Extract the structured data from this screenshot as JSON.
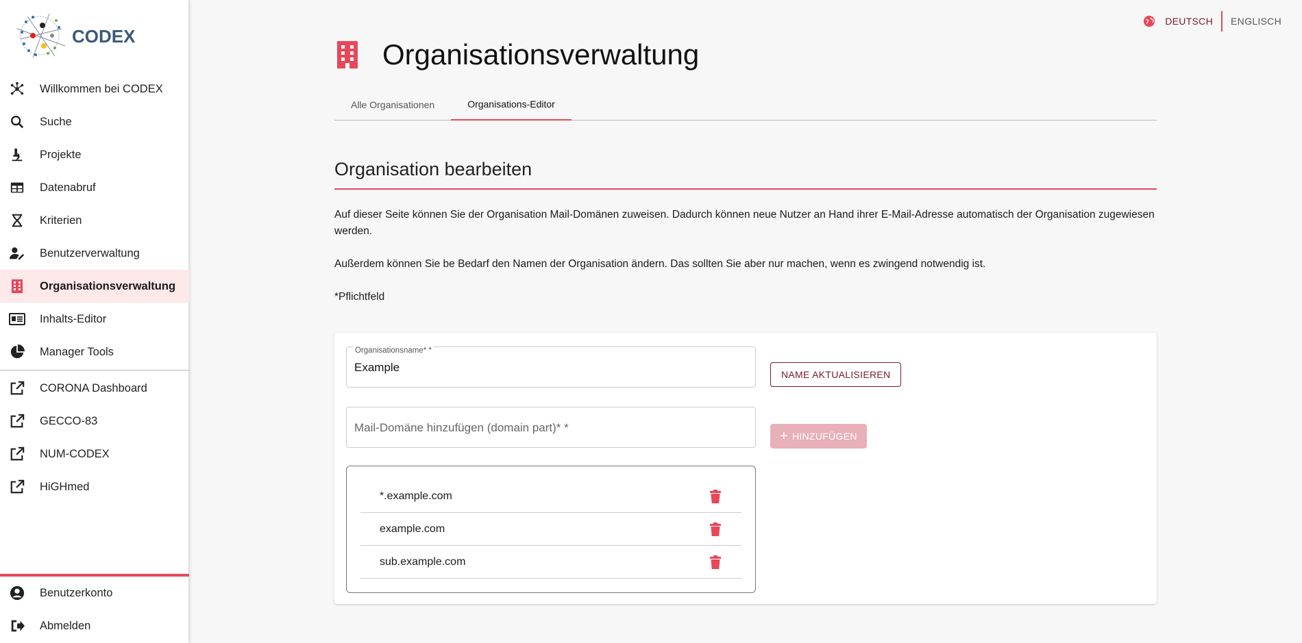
{
  "brand": {
    "name": "CODEX"
  },
  "colors": {
    "accent": "#e8475a",
    "accent_dark": "#7a1a2a",
    "active_bg": "#fde8ea"
  },
  "sidebar": {
    "items": [
      {
        "label": "Willkommen bei CODEX",
        "icon": "hub-icon"
      },
      {
        "label": "Suche",
        "icon": "search-icon"
      },
      {
        "label": "Projekte",
        "icon": "microscope-icon"
      },
      {
        "label": "Datenabruf",
        "icon": "table-icon"
      },
      {
        "label": "Kriterien",
        "icon": "dna-icon"
      },
      {
        "label": "Benutzerverwaltung",
        "icon": "user-edit-icon"
      },
      {
        "label": "Organisationsverwaltung",
        "icon": "building-icon",
        "active": true
      },
      {
        "label": "Inhalts-Editor",
        "icon": "newspaper-icon"
      },
      {
        "label": "Manager Tools",
        "icon": "pie-chart-icon"
      }
    ],
    "links": [
      {
        "label": "CORONA Dashboard",
        "icon": "external-link-icon"
      },
      {
        "label": "GECCO-83",
        "icon": "external-link-icon"
      },
      {
        "label": "NUM-CODEX",
        "icon": "external-link-icon"
      },
      {
        "label": "HiGHmed",
        "icon": "external-link-icon"
      }
    ],
    "bottom": [
      {
        "label": "Benutzerkonto",
        "icon": "account-circle-icon"
      },
      {
        "label": "Abmelden",
        "icon": "logout-icon"
      }
    ]
  },
  "language": {
    "current": "DEUTSCH",
    "other": "ENGLISCH"
  },
  "page": {
    "title": "Organisationsverwaltung",
    "tabs": [
      "Alle Organisationen",
      "Organisations-Editor"
    ],
    "active_tab": 1,
    "section_title": "Organisation bearbeiten",
    "paragraph1": "Auf dieser Seite können Sie der Organisation Mail-Domänen zuweisen. Dadurch können neue Nutzer an Hand ihrer E-Mail-Adresse automatisch der Organisation zugewiesen werden.",
    "paragraph2": "Außerdem können Sie be Bedarf den Namen der Organisation ändern. Das sollten Sie aber nur machen, wenn es zwingend notwendig ist.",
    "required_note": "*Pflichtfeld"
  },
  "form": {
    "name_label": "Organisationsname* *",
    "name_value": "Example",
    "update_button": "NAME AKTUALISIEREN",
    "domain_placeholder": "Mail-Domäne hinzufügen (domain part)* *",
    "add_button": "HINZUFÜGEN",
    "domains": [
      "*.example.com",
      "example.com",
      "sub.example.com"
    ]
  }
}
